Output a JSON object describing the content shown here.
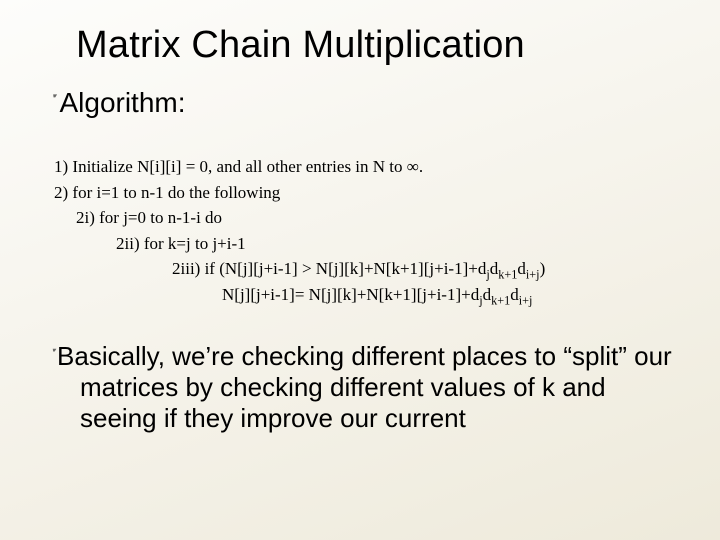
{
  "title": "Matrix Chain Multiplication",
  "bullet_glyph": "་",
  "section1": {
    "label": "Algorithm:"
  },
  "algo": {
    "l1": "1) Initialize N[i][i] = 0, and all other entries in N to ∞.",
    "l2": "2) for i=1 to n-1 do the following",
    "l3": "2i) for j=0 to n-1-i do",
    "l4": "2ii) for k=j to j+i-1",
    "l5a": "2iii) if (N[j][j+i-1] > N[j][k]+N[k+1][j+i-1]+d",
    "l5_s1": "j",
    "l5b": "d",
    "l5_s2": "k+1",
    "l5c": "d",
    "l5_s3": "i+j",
    "l5d": ")",
    "l6a": "N[j][j+i-1]= N[j][k]+N[k+1][j+i-1]+d",
    "l6_s1": "j",
    "l6b": "d",
    "l6_s2": "k+1",
    "l6c": "d",
    "l6_s3": "i+j"
  },
  "closing": {
    "lead": "Basically,",
    "rest": " we’re checking different places to “split” our matrices by checking different values of k and seeing if they improve our current"
  }
}
